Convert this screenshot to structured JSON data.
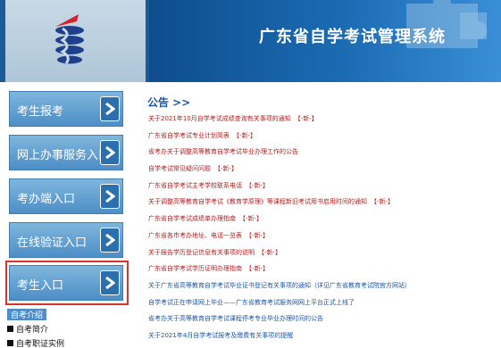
{
  "header": {
    "title": "广东省自学考试管理系统"
  },
  "sidebar": {
    "buttons": [
      {
        "label": "考生报考"
      },
      {
        "label": "网上办事服务入口"
      },
      {
        "label": "考办端入口"
      },
      {
        "label": "在线验证入口"
      },
      {
        "label": "考生入口"
      }
    ],
    "heading": "自考介绍",
    "items": [
      {
        "label": "自考简介"
      },
      {
        "label": "自考职证实例"
      }
    ]
  },
  "notices": {
    "title": "公告 >>",
    "new_tag": "【-新-】",
    "items": [
      {
        "text": "关于2021年10月自学考试成绩查询有关事项的通知",
        "color": "#b02020",
        "new": true
      },
      {
        "text": "广东省自学考试专业计划简表",
        "color": "#b02020",
        "new": true
      },
      {
        "text": "省考办关于调整高等教育自学考试毕业办理工作的公告",
        "color": "#b02020",
        "new": false
      },
      {
        "text": "自学考试常见疑问问题",
        "color": "#b02020",
        "new": true
      },
      {
        "text": "广东省自学考试主考学校联系电话",
        "color": "#b02020",
        "new": true
      },
      {
        "text": "关于调整高等教育自学考试《教育学原理》等课程新旧考试用书启用时间的通知",
        "color": "#b02020",
        "new": true
      },
      {
        "text": "广东省自学考试成绩单办理指南",
        "color": "#b02020",
        "new": true
      },
      {
        "text": "广东省各市考办地址、电话一览表",
        "color": "#b02020",
        "new": true
      },
      {
        "text": "关于报告学历登记信息有关事项的说明",
        "color": "#b02020",
        "new": true
      },
      {
        "text": "广东省自学考试学历证明办理指南",
        "color": "#b02020",
        "new": true
      },
      {
        "text": "关于广东省高等教育自学考试毕业证书登记有关事项的通知（详见广东省教育考试院官方网站）",
        "color": "#1d57a6",
        "new": false
      },
      {
        "text": "自学考试正在申请网上毕业——广东省教育考试服务网网上平台正式上线了",
        "color": "#1d57a6",
        "new": false
      },
      {
        "text": "省考办关于高等教育自学考试课程停考专业毕业办理时间的公告",
        "color": "#1d57a6",
        "new": false
      },
      {
        "text": "关于2021年4月自学考试报考及缴费有关事项的提醒",
        "color": "#1d57a6",
        "new": false
      }
    ]
  }
}
